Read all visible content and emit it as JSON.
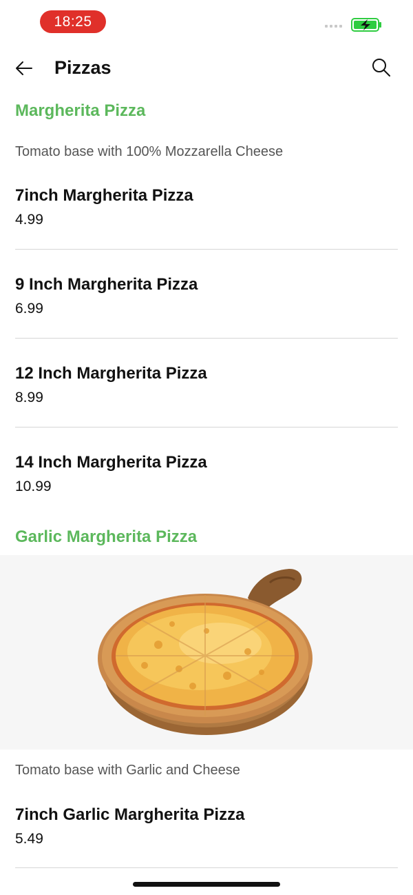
{
  "status_bar": {
    "time": "18:25",
    "battery_color": "#2ecc40",
    "pill_color": "#e0302a"
  },
  "header": {
    "title": "Pizzas"
  },
  "accent_color": "#5cb85c",
  "sections": [
    {
      "title": "Margherita Pizza",
      "description": "Tomato base with 100% Mozzarella Cheese",
      "items": [
        {
          "name": "7inch Margherita Pizza",
          "price": "4.99"
        },
        {
          "name": "9 Inch Margherita Pizza",
          "price": "6.99"
        },
        {
          "name": "12 Inch Margherita Pizza",
          "price": "8.99"
        },
        {
          "name": "14 Inch Margherita Pizza",
          "price": "10.99"
        }
      ]
    },
    {
      "title": "Garlic Margherita Pizza",
      "image": "cheese-pizza-on-wooden-board",
      "description": "Tomato base with Garlic and Cheese",
      "items": [
        {
          "name": "7inch Garlic Margherita Pizza",
          "price": "5.49"
        }
      ]
    }
  ]
}
